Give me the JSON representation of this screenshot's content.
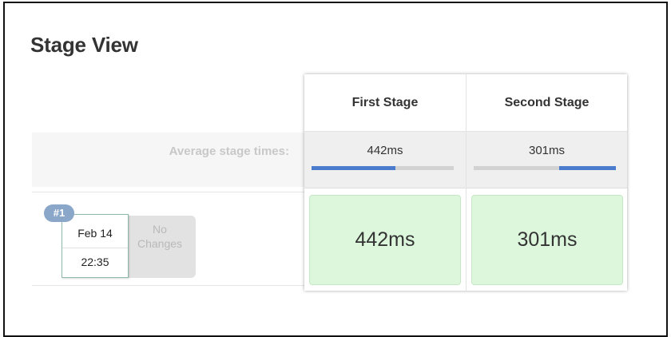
{
  "page": {
    "title": "Stage View"
  },
  "average": {
    "label": "Average stage times:"
  },
  "stages": [
    {
      "name": "First Stage",
      "avg_time": "442ms",
      "avg_progress": 0.59,
      "run_time": "442ms"
    },
    {
      "name": "Second Stage",
      "avg_time": "301ms",
      "avg_progress": 0.4,
      "run_time": "301ms"
    }
  ],
  "build": {
    "number": "#1",
    "date": "Feb 14",
    "time": "22:35",
    "changes_line1": "No",
    "changes_line2": "Changes"
  },
  "colors": {
    "progress": "#4b7bcc",
    "success_cell": "#dcf7dc",
    "badge": "#8aa6c8"
  }
}
